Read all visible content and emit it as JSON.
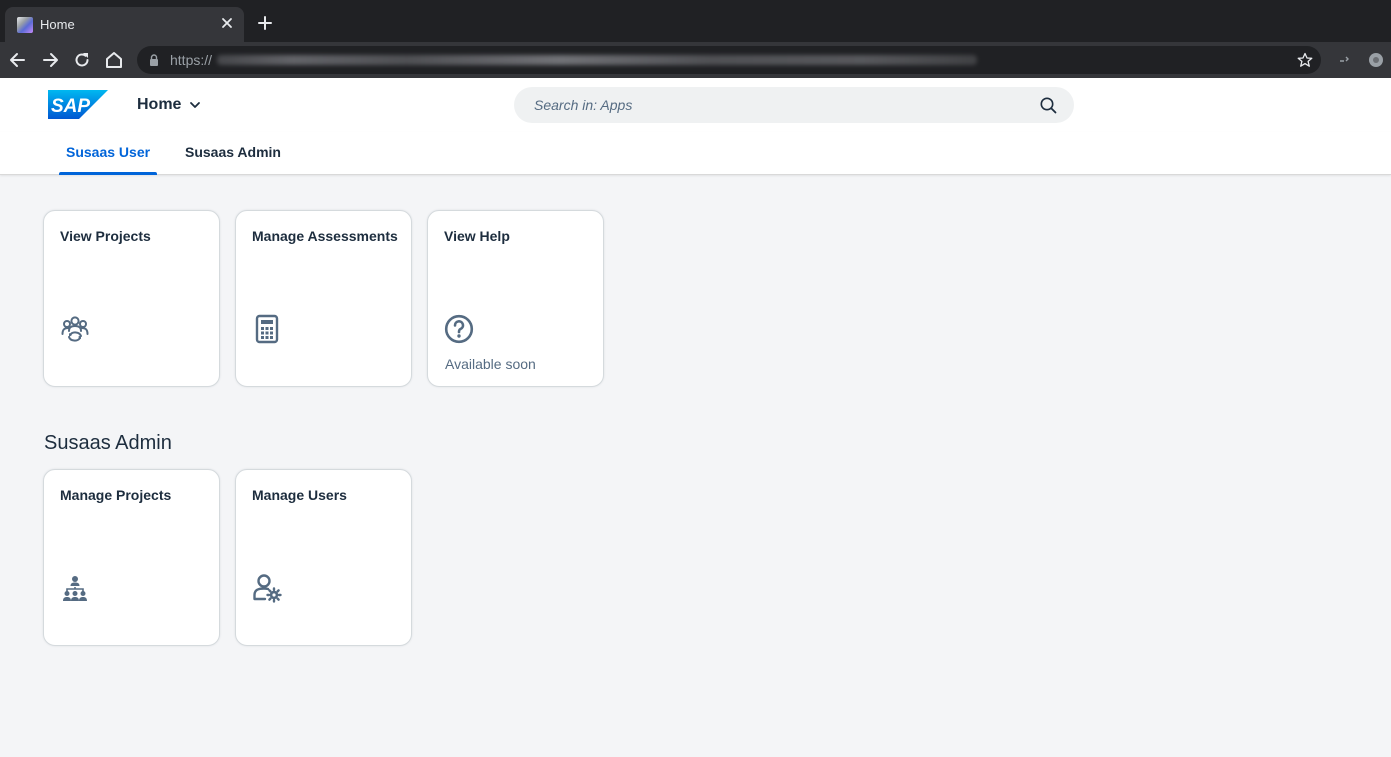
{
  "browser": {
    "tab_title": "Home",
    "url_prefix": "https://"
  },
  "shell": {
    "logo_text": "SAP",
    "app_title": "Home",
    "search_placeholder": "Search in: Apps"
  },
  "tabs": [
    {
      "label": "Susaas User",
      "active": true
    },
    {
      "label": "Susaas Admin",
      "active": false
    }
  ],
  "user_tiles": [
    {
      "title": "View Projects",
      "icon": "group-refresh-icon",
      "footer": ""
    },
    {
      "title": "Manage Assessments",
      "icon": "calculator-icon",
      "footer": ""
    },
    {
      "title": "View Help",
      "icon": "question-mark-icon",
      "footer": "Available soon"
    }
  ],
  "admin_section": {
    "title": "Susaas Admin",
    "tiles": [
      {
        "title": "Manage Projects",
        "icon": "org-hierarchy-icon",
        "footer": ""
      },
      {
        "title": "Manage Users",
        "icon": "user-settings-icon",
        "footer": ""
      }
    ]
  },
  "colors": {
    "accent": "#0064d9",
    "icon": "#556b82",
    "text": "#1d2d3e"
  }
}
